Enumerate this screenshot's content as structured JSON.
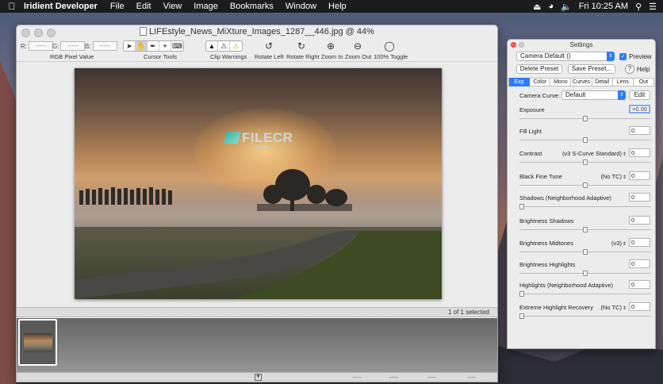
{
  "menubar": {
    "app_name": "Iridient Developer",
    "items": [
      "File",
      "Edit",
      "View",
      "Image",
      "Bookmarks",
      "Window",
      "Help"
    ],
    "clock": "Fri 10:25 AM"
  },
  "main_window": {
    "title": "LIFEstyle_News_MiXture_Images_1287__446.jpg @ 44%",
    "rgb": {
      "r_label": "R:",
      "g_label": "G:",
      "b_label": "B:",
      "placeholder": "-----",
      "caption": "RGB Pixel Value"
    },
    "cursor_tools_label": "Cursor Tools",
    "clip_warnings_label": "Clip Warnings",
    "buttons": {
      "rotate_left": "Rotate Left",
      "rotate_right": "Rotate Right",
      "zoom_in": "Zoom In",
      "zoom_out": "Zoom Out",
      "toggle_100": "100% Toggle"
    },
    "watermark": {
      "text": "FILECR",
      "sub": ".com"
    },
    "status": "1 of 1 selected",
    "bottom_dashes": [
      "----",
      "----",
      "----",
      "----"
    ]
  },
  "settings": {
    "title": "Settings",
    "preset": "Camera Default ()",
    "preview_label": "Preview",
    "delete_preset": "Delete Preset",
    "save_preset": "Save Preset...",
    "help_label": "Help",
    "tabs": [
      "Exp",
      "Color",
      "Mono",
      "Curves",
      "Detail",
      "Lens",
      "Out"
    ],
    "active_tab": "Exp",
    "camera_curve_label": "Camera Curve:",
    "camera_curve_value": "Default",
    "edit_label": "Edit",
    "rows": [
      {
        "label": "Exposure",
        "mode": "",
        "value": "+0.00",
        "slider": 0.5
      },
      {
        "label": "Fill Light",
        "mode": "",
        "value": "0",
        "slider": 0.5
      },
      {
        "label": "Contrast",
        "mode": "(v3 S-Curve Standard)",
        "value": "0",
        "slider": 0.5
      },
      {
        "label": "Black Fine Tune",
        "mode": "(No TC)",
        "value": "0",
        "slider": 0.5
      },
      {
        "label": "Shadows (Neighborhood Adaptive)",
        "mode": "",
        "value": "0",
        "slider": 0.0
      },
      {
        "label": "Brightness Shadows",
        "mode": "",
        "value": "0",
        "slider": 0.5
      },
      {
        "label": "Brightness Midtones",
        "mode": "(v3)",
        "value": "0",
        "slider": 0.5
      },
      {
        "label": "Brightness Highlights",
        "mode": "",
        "value": "0",
        "slider": 0.5
      },
      {
        "label": "Highlights (Neighborhood Adaptive)",
        "mode": "",
        "value": "0",
        "slider": 0.0
      },
      {
        "label": "Extreme Highlight Recovery",
        "mode": "(No TC)",
        "value": "0",
        "slider": 0.0
      }
    ]
  }
}
